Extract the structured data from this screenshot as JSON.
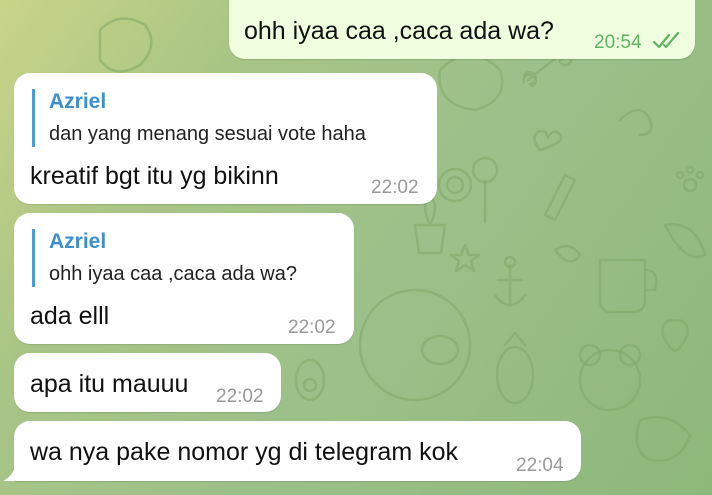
{
  "messages": [
    {
      "direction": "outgoing",
      "text": "ohh iyaa caa ,caca ada wa?",
      "time": "20:54",
      "read": true
    },
    {
      "direction": "incoming",
      "reply": {
        "name": "Azriel",
        "text": "dan yang menang sesuai vote haha"
      },
      "text": "kreatif bgt itu yg bikinn",
      "time": "22:02"
    },
    {
      "direction": "incoming",
      "reply": {
        "name": "Azriel",
        "text": "ohh iyaa caa ,caca ada wa?"
      },
      "text": "ada elll",
      "time": "22:02"
    },
    {
      "direction": "incoming",
      "text": "apa itu mauuu",
      "time": "22:02"
    },
    {
      "direction": "incoming",
      "text": "wa nya pake nomor yg di telegram kok",
      "time": "22:04"
    }
  ],
  "colors": {
    "wallpaper": "#a3c285",
    "incoming_bubble": "#ffffff",
    "outgoing_bubble": "#eefedf",
    "reply_accent": "#3d8fd0",
    "outgoing_time": "#5eb560",
    "incoming_time": "#9a9a9a"
  },
  "icons": {
    "read_receipt": "double-check-icon",
    "wallpaper_pattern": "doodle-pattern"
  }
}
